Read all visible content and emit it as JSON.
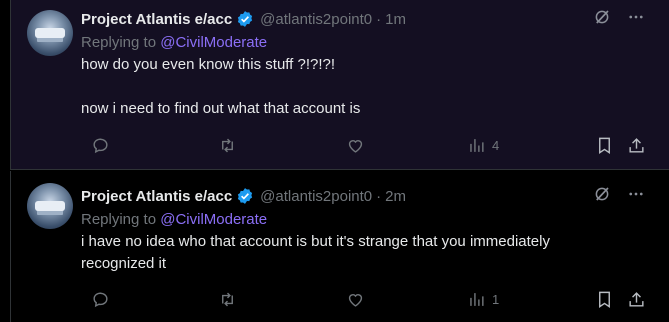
{
  "tweets": [
    {
      "author": "Project Atlantis e/acc",
      "handle": "@atlantis2point0",
      "separator": "·",
      "time": "1m",
      "replying_prefix": "Replying to",
      "replying_to": "@CivilModerate",
      "lines": [
        "how do you even know this stuff ?!?!?!",
        "",
        "now i need to find out what that account is"
      ],
      "views": "4"
    },
    {
      "author": "Project Atlantis e/acc",
      "handle": "@atlantis2point0",
      "separator": "·",
      "time": "2m",
      "replying_prefix": "Replying to",
      "replying_to": "@CivilModerate",
      "lines": [
        "i have no idea who that account is but it's strange that you immediately",
        "recognized it"
      ],
      "views": "1"
    }
  ],
  "colors": {
    "accent": "#8b6ff6",
    "verified": "#1d9bf0",
    "muted": "#71767b"
  },
  "icons": [
    "verified-badge-icon",
    "grok-icon",
    "more-icon",
    "reply-icon",
    "retweet-icon",
    "like-icon",
    "views-icon",
    "bookmark-icon",
    "share-icon"
  ]
}
